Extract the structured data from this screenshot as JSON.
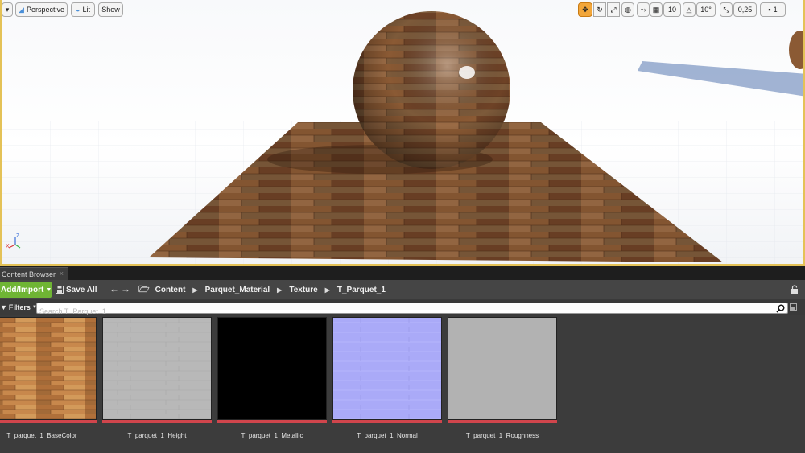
{
  "viewport": {
    "options_icon": "chevron-down-icon",
    "perspective_label": "Perspective",
    "lit_label": "Lit",
    "show_label": "Show",
    "grid_snap_value": "10",
    "rotation_snap_value": "10°",
    "scale_snap_value": "0,25",
    "camera_speed_value": "1",
    "axis_labels": [
      "Z",
      "X"
    ],
    "colors": {
      "selection_border": "#e4c257",
      "active_tool": "#f2a63a"
    }
  },
  "content_browser": {
    "tab_title": "Content Browser",
    "add_import_label": "Add/Import",
    "save_all_label": "Save All",
    "breadcrumbs": [
      "Content",
      "Parquet_Material",
      "Texture",
      "T_Parquet_1"
    ],
    "filters_label": "Filters",
    "search_placeholder": "Search T_Parquet_1",
    "assets": [
      {
        "name": "T_parquet_1_BaseColor",
        "thumb": "wood"
      },
      {
        "name": "T_parquet_1_Height",
        "thumb": "height"
      },
      {
        "name": "T_parquet_1_Metallic",
        "thumb": "black"
      },
      {
        "name": "T_parquet_1_Normal",
        "thumb": "normal"
      },
      {
        "name": "T_parquet_1_Roughness",
        "thumb": "grey"
      }
    ],
    "colors": {
      "add_import": "#6fb534",
      "texture_bar": "#d0454c"
    }
  }
}
